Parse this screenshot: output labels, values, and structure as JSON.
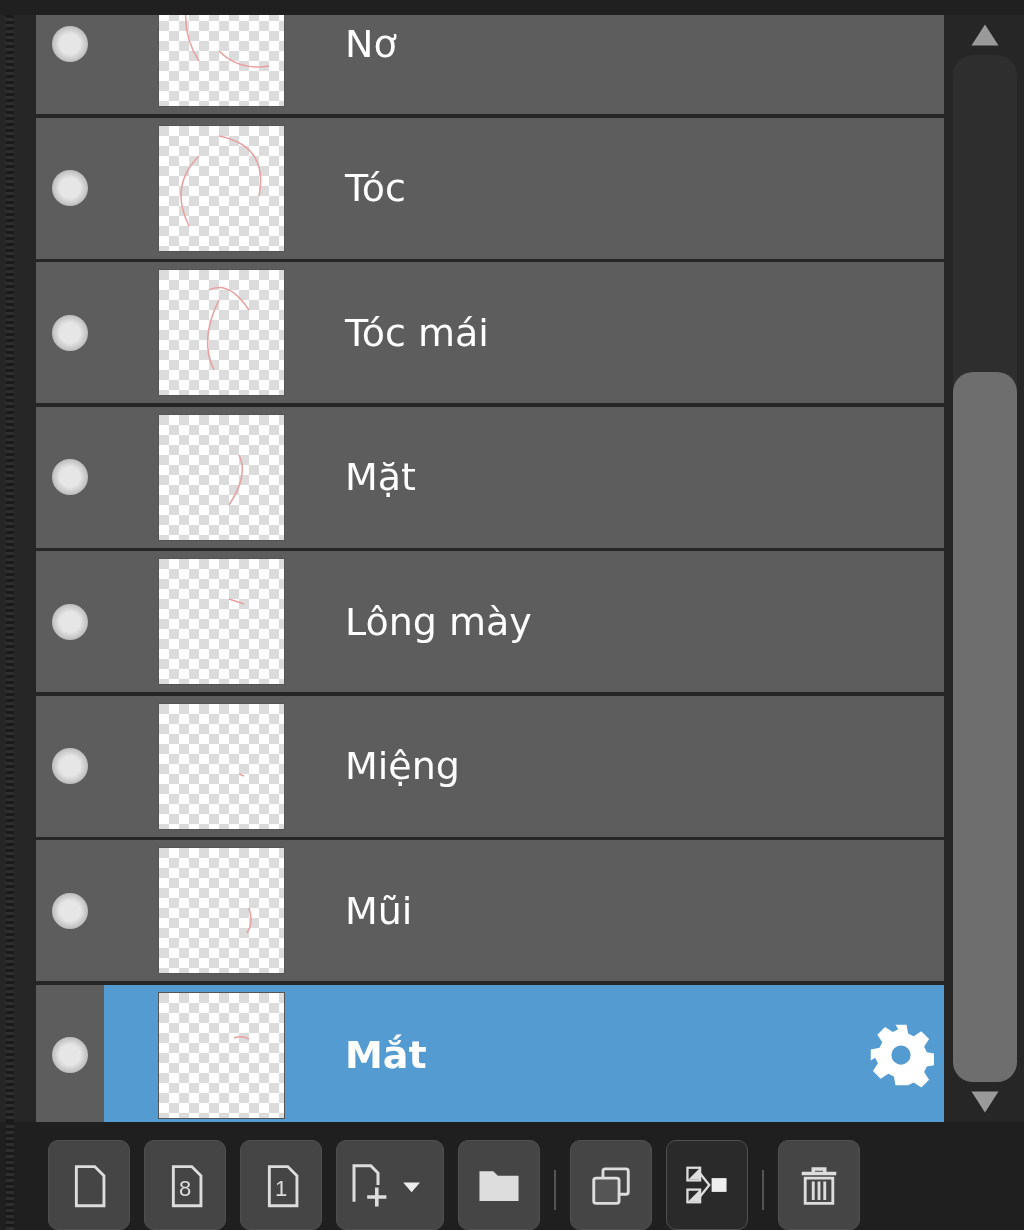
{
  "layers": [
    {
      "name": "Nơ",
      "visible": true,
      "selected": false
    },
    {
      "name": "Tóc",
      "visible": true,
      "selected": false
    },
    {
      "name": "Tóc mái",
      "visible": true,
      "selected": false
    },
    {
      "name": "Mặt",
      "visible": true,
      "selected": false
    },
    {
      "name": "Lông mày",
      "visible": true,
      "selected": false
    },
    {
      "name": "Miệng",
      "visible": true,
      "selected": false
    },
    {
      "name": "Mũi",
      "visible": true,
      "selected": false
    },
    {
      "name": "Mắt",
      "visible": true,
      "selected": true
    }
  ],
  "toolbar": [
    {
      "kind": "new"
    },
    {
      "kind": "new-numbered",
      "label": "8"
    },
    {
      "kind": "new-numbered",
      "label": "1"
    },
    {
      "kind": "add-dropdown"
    },
    {
      "kind": "folder"
    },
    {
      "kind": "separator"
    },
    {
      "kind": "duplicate"
    },
    {
      "kind": "merge"
    },
    {
      "kind": "separator"
    },
    {
      "kind": "delete"
    }
  ]
}
